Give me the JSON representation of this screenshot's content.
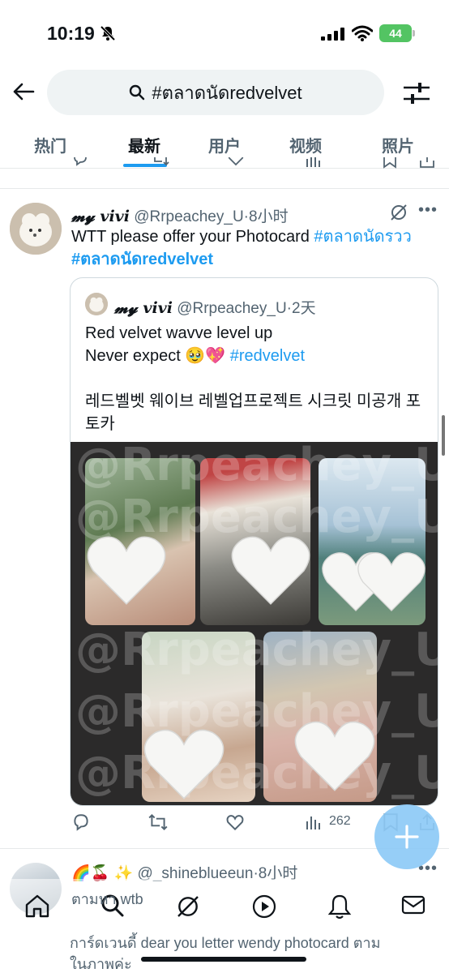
{
  "status_bar": {
    "time": "10:19",
    "battery": "44"
  },
  "search": {
    "query": "#ตลาดนัดredvelvet"
  },
  "tabs": [
    {
      "label": "热门",
      "active": false
    },
    {
      "label": "最新",
      "active": true
    },
    {
      "label": "用户",
      "active": false
    },
    {
      "label": "视频",
      "active": false
    },
    {
      "label": "照片",
      "active": false
    }
  ],
  "tweet": {
    "display_name": "𝓶𝔂 vivi",
    "handle": "@Rrpeachey_U",
    "time": "·8小时",
    "text": "WTT please offer your Photocard ",
    "hashtag1": "#ตลาดนัดรวว",
    "hashtag2": "#ตลาดนัดredvelvet",
    "quote": {
      "display_name": "𝓶𝔂 vivi",
      "handle": "@Rrpeachey_U",
      "time": "·2天",
      "line1": "Red velvet wavve level up",
      "line2_prefix": "Never expect 🥹💖 ",
      "line2_hashtag": "#redvelvet",
      "line3": "레드벨벳 웨이브 레벨업프로젝트 시크릿 미공개 포토카",
      "watermark": "@Rrpeachey_U"
    },
    "views": "262"
  },
  "next_tweet": {
    "emojis": "🌈🍒 ✨",
    "handle": "@_shineblueeun",
    "time": "·8小时",
    "line1": "ตามหา wtb",
    "line2": "การ์ดเวนดี้ dear you letter wendy photocard ตาม",
    "line3": "ในภาพค่ะ"
  },
  "colors": {
    "accent": "#1d9bf0",
    "fab": "#8ecaf7",
    "battery": "#53c463"
  }
}
